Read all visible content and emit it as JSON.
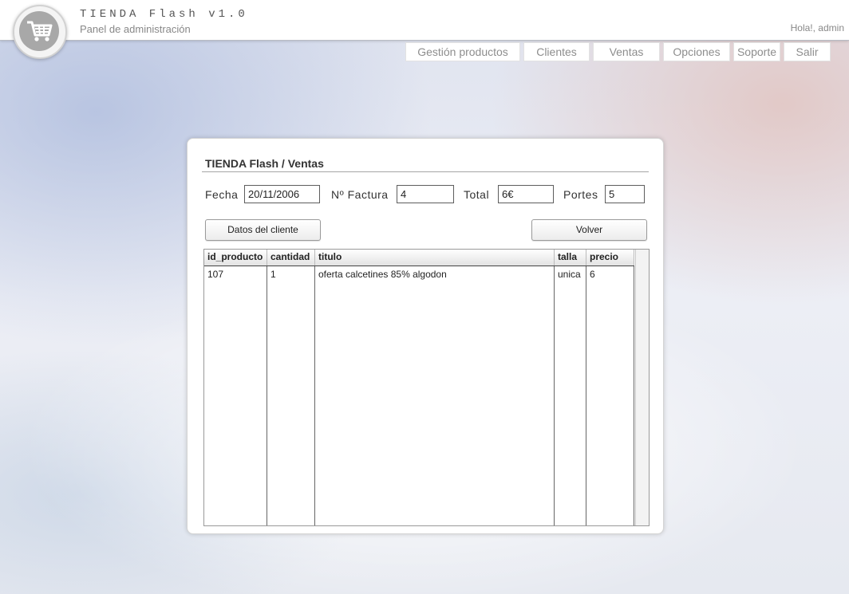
{
  "app": {
    "title": "TIENDA Flash v1.0",
    "subtitle": "Panel de administración",
    "greeting": "Hola!, admin"
  },
  "nav": {
    "items": [
      {
        "label": "Gestión productos"
      },
      {
        "label": "Clientes"
      },
      {
        "label": "Ventas"
      },
      {
        "label": "Opciones"
      },
      {
        "label": "Soporte"
      },
      {
        "label": "Salir"
      }
    ]
  },
  "panel": {
    "title": "TIENDA Flash / Ventas",
    "fields": {
      "fecha": {
        "label": "Fecha",
        "value": "20/11/2006"
      },
      "factura": {
        "label": "Nº Factura",
        "value": "4"
      },
      "total": {
        "label": "Total",
        "value": "6€"
      },
      "portes": {
        "label": "Portes",
        "value": "5"
      }
    },
    "buttons": {
      "cliente": "Datos del cliente",
      "volver": "Volver"
    }
  },
  "table": {
    "columns": [
      "id_producto",
      "cantidad",
      "titulo",
      "talla",
      "precio"
    ],
    "rows": [
      [
        "107",
        "1",
        "oferta calcetines 85% algodon",
        "unica",
        "6"
      ]
    ]
  }
}
